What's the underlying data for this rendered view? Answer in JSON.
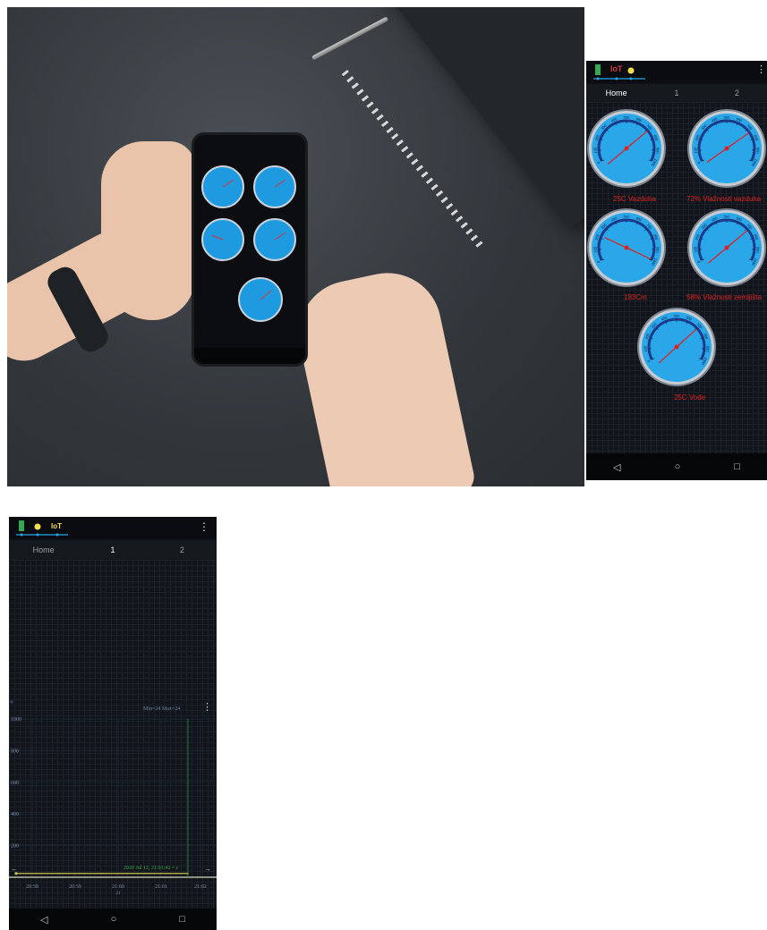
{
  "app": {
    "tabs": [
      "Home",
      "1",
      "2"
    ],
    "home_tab_active": "Home",
    "one_tab_active": "1",
    "logo_text": "IoT",
    "menu_icon": "overflow-menu-icon"
  },
  "nav": {
    "back": "◁",
    "home": "○",
    "recent": "□",
    "back_icon": "back-triangle-icon",
    "home_icon": "home-circle-icon",
    "recent_icon": "recent-square-icon"
  },
  "gauges": [
    {
      "label": "25C Vazduha"
    },
    {
      "label": "72% Vlažnosti vazduha"
    },
    {
      "label": "183Cm"
    },
    {
      "label": "58% Vlažnosti zemljišta"
    },
    {
      "label": "25C Vode"
    }
  ],
  "gauge_ticks": [
    "0",
    "100",
    "200",
    "300",
    "400",
    "500",
    "600",
    "700",
    "800",
    "900",
    "1000"
  ],
  "chart": {
    "type": "line",
    "min_max": "Min=24  Max=24",
    "y_ticks": [
      "1000",
      "800",
      "600",
      "400",
      "200"
    ],
    "x_ticks": [
      "20:58",
      "20:59",
      "21:00",
      "21:01",
      "21:02"
    ],
    "x_subticks": [
      "",
      "",
      "21",
      "",
      ""
    ],
    "timestamp": "2020 Jul 12, 21:01:42 = c",
    "ylim": [
      0,
      1000
    ],
    "values": [
      24,
      24,
      24,
      24,
      24
    ],
    "color_line": "#c8c050",
    "color_cursor": "#2f8f3f",
    "prev_arrow": "«",
    "pan_left": "←",
    "pan_right": "→"
  },
  "colors": {
    "accent": "#2aa7e8",
    "gauge_label": "#e02020",
    "bg": "#0d1016"
  }
}
